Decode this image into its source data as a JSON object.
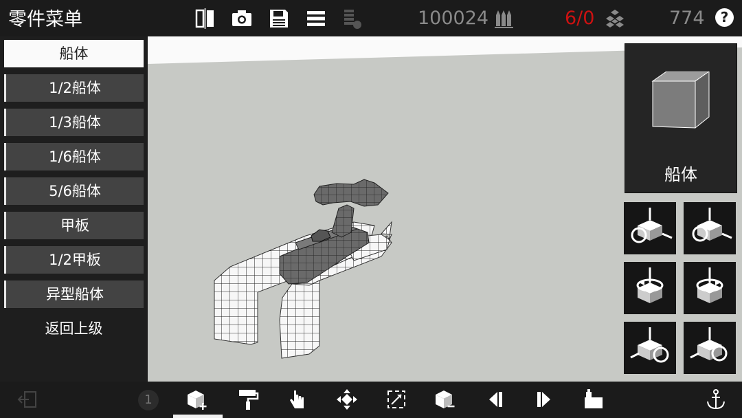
{
  "header": {
    "title": "零件菜单",
    "part_count": "100024",
    "ammo_ratio": "6/0",
    "money": "774",
    "help_label": "?"
  },
  "sidebar": {
    "items": [
      {
        "label": "船体",
        "selected": true
      },
      {
        "label": "1/2船体",
        "selected": false
      },
      {
        "label": "1/3船体",
        "selected": false
      },
      {
        "label": "1/6船体",
        "selected": false
      },
      {
        "label": "5/6船体",
        "selected": false
      },
      {
        "label": "甲板",
        "selected": false
      },
      {
        "label": "1/2甲板",
        "selected": false
      },
      {
        "label": "异型船体",
        "selected": false
      }
    ],
    "back_label": "返回上级"
  },
  "preview": {
    "label": "船体"
  },
  "bottom": {
    "page_indicator": "1",
    "active_tool": "add-part"
  },
  "colors": {
    "ammo_ratio": "#cc1111",
    "viewport_bg": "#c7c9c5",
    "bar_bg": "#1b1b1b"
  }
}
